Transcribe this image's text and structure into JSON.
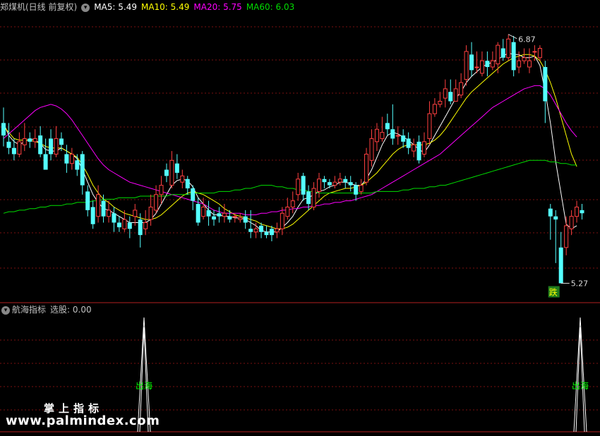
{
  "header": {
    "stock_title": "郑煤机(日线 前复权)",
    "dropdown_icon": "chevron-down-icon",
    "ma5_label": "MA5: 5.49",
    "ma10_label": "MA10: 5.49",
    "ma20_label": "MA20: 5.75",
    "ma60_label": "MA60: 6.03"
  },
  "sub_header": {
    "indicator_name": "航海指标",
    "select_label": "选股: 0.00",
    "dropdown_icon": "chevron-down-icon"
  },
  "colors": {
    "up": "#ff4040",
    "down": "#54ffff",
    "ma5": "#ffffff",
    "ma10": "#ffff00",
    "ma20": "#ff00ff",
    "ma60": "#00dd00",
    "grid": "#7a1010",
    "signal": "#00ff00",
    "fall_badge_bg": "#1e7a1e"
  },
  "watermark": {
    "line1": "掌上指标",
    "line2": "www.palmindex.com"
  },
  "chart_data": [
    {
      "type": "candlestick",
      "title": "郑煤机(日线 前复权)",
      "ylim": [
        5.15,
        7.0
      ],
      "grid": true,
      "annotations": {
        "high_label": "6.87",
        "low_label": "5.27",
        "fall_label": "跌"
      },
      "candles": [
        [
          6.3,
          6.22,
          6.4,
          6.15
        ],
        [
          6.18,
          6.14,
          6.3,
          6.1
        ],
        [
          6.14,
          6.1,
          6.2,
          6.06
        ],
        [
          6.1,
          6.18,
          6.24,
          6.08
        ],
        [
          6.16,
          6.2,
          6.3,
          6.12
        ],
        [
          6.2,
          6.18,
          6.24,
          6.14
        ],
        [
          6.18,
          6.2,
          6.26,
          6.14
        ],
        [
          6.22,
          6.1,
          6.28,
          6.08
        ],
        [
          6.1,
          6.0,
          6.2,
          6.0
        ],
        [
          6.2,
          6.1,
          6.26,
          6.06
        ],
        [
          6.1,
          6.2,
          6.28,
          6.08
        ],
        [
          6.2,
          6.16,
          6.24,
          6.12
        ],
        [
          6.1,
          6.04,
          6.16,
          5.98
        ],
        [
          6.04,
          6.1,
          6.14,
          6.0
        ],
        [
          6.06,
          6.0,
          6.1,
          5.96
        ],
        [
          6.1,
          5.9,
          6.12,
          5.84
        ],
        [
          5.86,
          5.74,
          5.9,
          5.7
        ],
        [
          5.76,
          5.65,
          5.8,
          5.62
        ],
        [
          5.7,
          5.84,
          5.9,
          5.66
        ],
        [
          5.8,
          5.7,
          5.84,
          5.66
        ],
        [
          5.7,
          5.74,
          5.8,
          5.66
        ],
        [
          5.72,
          5.66,
          5.76,
          5.6
        ],
        [
          5.66,
          5.63,
          5.7,
          5.6
        ],
        [
          5.62,
          5.68,
          5.74,
          5.6
        ],
        [
          5.66,
          5.62,
          5.7,
          5.56
        ],
        [
          5.7,
          5.74,
          5.78,
          5.64
        ],
        [
          5.68,
          5.58,
          5.72,
          5.5
        ],
        [
          5.62,
          5.66,
          5.74,
          5.58
        ],
        [
          5.68,
          5.76,
          5.84,
          5.64
        ],
        [
          5.74,
          5.84,
          5.9,
          5.72
        ],
        [
          5.84,
          5.9,
          5.96,
          5.78
        ],
        [
          6.0,
          5.96,
          6.04,
          5.92
        ],
        [
          5.9,
          6.06,
          6.12,
          5.88
        ],
        [
          6.04,
          5.98,
          6.1,
          5.94
        ],
        [
          5.92,
          5.96,
          6.0,
          5.88
        ],
        [
          5.94,
          5.88,
          5.96,
          5.84
        ],
        [
          5.88,
          5.8,
          5.9,
          5.74
        ],
        [
          5.78,
          5.66,
          5.82,
          5.64
        ],
        [
          5.7,
          5.76,
          5.82,
          5.68
        ],
        [
          5.74,
          5.7,
          5.8,
          5.64
        ],
        [
          5.7,
          5.68,
          5.74,
          5.64
        ],
        [
          5.72,
          5.7,
          5.76,
          5.66
        ],
        [
          5.7,
          5.72,
          5.78,
          5.66
        ],
        [
          5.7,
          5.68,
          5.74,
          5.66
        ],
        [
          5.7,
          5.7,
          5.72,
          5.66
        ],
        [
          5.68,
          5.69,
          5.72,
          5.66
        ],
        [
          5.7,
          5.66,
          5.74,
          5.62
        ],
        [
          5.62,
          5.6,
          5.74,
          5.56
        ],
        [
          5.6,
          5.62,
          5.66,
          5.56
        ],
        [
          5.64,
          5.6,
          5.66,
          5.56
        ],
        [
          5.6,
          5.58,
          5.64,
          5.56
        ],
        [
          5.62,
          5.58,
          5.64,
          5.54
        ],
        [
          5.6,
          5.62,
          5.66,
          5.56
        ],
        [
          5.62,
          5.72,
          5.76,
          5.58
        ],
        [
          5.7,
          5.76,
          5.82,
          5.68
        ],
        [
          5.76,
          5.8,
          5.86,
          5.72
        ],
        [
          5.84,
          5.94,
          5.98,
          5.8
        ],
        [
          5.96,
          5.84,
          5.98,
          5.8
        ],
        [
          5.86,
          5.78,
          5.9,
          5.74
        ],
        [
          5.76,
          5.88,
          5.92,
          5.74
        ],
        [
          5.86,
          5.94,
          5.98,
          5.82
        ],
        [
          5.94,
          5.92,
          5.96,
          5.88
        ],
        [
          5.92,
          5.9,
          5.94,
          5.88
        ],
        [
          5.9,
          5.92,
          5.96,
          5.88
        ],
        [
          5.92,
          5.94,
          5.98,
          5.9
        ],
        [
          5.94,
          5.92,
          5.96,
          5.88
        ],
        [
          5.92,
          5.9,
          5.96,
          5.86
        ],
        [
          5.9,
          5.84,
          5.92,
          5.8
        ],
        [
          5.86,
          5.9,
          5.94,
          5.84
        ],
        [
          5.92,
          6.1,
          6.14,
          5.9
        ],
        [
          6.06,
          6.2,
          6.26,
          6.02
        ],
        [
          6.18,
          6.26,
          6.3,
          6.12
        ],
        [
          6.2,
          6.24,
          6.34,
          6.18
        ],
        [
          6.3,
          6.26,
          6.36,
          6.22
        ],
        [
          6.26,
          6.2,
          6.42,
          6.16
        ],
        [
          6.22,
          6.22,
          6.28,
          6.16
        ],
        [
          6.22,
          6.18,
          6.26,
          6.14
        ],
        [
          6.2,
          6.14,
          6.24,
          6.1
        ],
        [
          6.12,
          6.16,
          6.2,
          6.08
        ],
        [
          6.18,
          6.06,
          6.22,
          6.04
        ],
        [
          6.1,
          6.18,
          6.24,
          6.08
        ],
        [
          6.2,
          6.36,
          6.44,
          6.16
        ],
        [
          6.36,
          6.42,
          6.46,
          6.34
        ],
        [
          6.42,
          6.44,
          6.5,
          6.4
        ],
        [
          6.46,
          6.52,
          6.58,
          6.4
        ],
        [
          6.5,
          6.44,
          6.58,
          6.42
        ],
        [
          6.44,
          6.52,
          6.58,
          6.44
        ],
        [
          6.48,
          6.56,
          6.62,
          6.46
        ],
        [
          6.58,
          6.76,
          6.8,
          6.54
        ],
        [
          6.74,
          6.64,
          6.82,
          6.6
        ],
        [
          6.66,
          6.66,
          6.76,
          6.62
        ],
        [
          6.62,
          6.7,
          6.76,
          6.6
        ],
        [
          6.7,
          6.66,
          6.76,
          6.6
        ],
        [
          6.66,
          6.7,
          6.76,
          6.64
        ],
        [
          6.68,
          6.8,
          6.82,
          6.62
        ],
        [
          6.78,
          6.72,
          6.84,
          6.7
        ],
        [
          6.72,
          6.84,
          6.87,
          6.7
        ],
        [
          6.82,
          6.64,
          6.86,
          6.6
        ],
        [
          6.66,
          6.7,
          6.76,
          6.62
        ],
        [
          6.7,
          6.72,
          6.78,
          6.68
        ],
        [
          6.66,
          6.7,
          6.78,
          6.62
        ],
        [
          6.76,
          6.76,
          6.8,
          6.7
        ],
        [
          6.72,
          6.78,
          6.8,
          6.7
        ],
        [
          6.66,
          6.44,
          6.7,
          6.3
        ],
        [
          5.75,
          5.7,
          5.78,
          5.55
        ],
        [
          5.7,
          5.68,
          5.74,
          5.4
        ],
        [
          5.5,
          5.27,
          5.6,
          5.27
        ],
        [
          5.5,
          5.64,
          5.7,
          5.45
        ],
        [
          5.62,
          5.7,
          5.74,
          5.58
        ],
        [
          5.7,
          5.76,
          5.8,
          5.66
        ],
        [
          5.74,
          5.72,
          5.78,
          5.68
        ]
      ],
      "series": [
        {
          "name": "MA5",
          "values": [
            6.3,
            6.22,
            6.18,
            6.16,
            6.18,
            6.2,
            6.19,
            6.17,
            6.13,
            6.12,
            6.12,
            6.14,
            6.12,
            6.1,
            6.07,
            6.0,
            5.92,
            5.84,
            5.79,
            5.75,
            5.74,
            5.72,
            5.7,
            5.68,
            5.66,
            5.66,
            5.66,
            5.66,
            5.68,
            5.72,
            5.78,
            5.84,
            5.9,
            5.93,
            5.94,
            5.93,
            5.89,
            5.82,
            5.78,
            5.74,
            5.71,
            5.71,
            5.7,
            5.7,
            5.69,
            5.69,
            5.68,
            5.66,
            5.64,
            5.61,
            5.6,
            5.6,
            5.6,
            5.63,
            5.66,
            5.7,
            5.76,
            5.81,
            5.82,
            5.84,
            5.86,
            5.87,
            5.89,
            5.9,
            5.92,
            5.92,
            5.91,
            5.9,
            5.9,
            5.94,
            6.0,
            6.08,
            6.16,
            6.22,
            6.24,
            6.23,
            6.21,
            6.19,
            6.16,
            6.13,
            6.11,
            6.16,
            6.22,
            6.28,
            6.34,
            6.4,
            6.46,
            6.5,
            6.56,
            6.6,
            6.63,
            6.66,
            6.68,
            6.69,
            6.71,
            6.73,
            6.75,
            6.74,
            6.74,
            6.72,
            6.72,
            6.73,
            6.67,
            6.5,
            6.3,
            6.05,
            5.85,
            5.65,
            5.62,
            5.64
          ]
        },
        {
          "name": "MA10",
          "values": [
            6.28,
            6.24,
            6.2,
            6.19,
            6.19,
            6.19,
            6.18,
            6.17,
            6.15,
            6.14,
            6.14,
            6.14,
            6.12,
            6.1,
            6.08,
            6.03,
            5.97,
            5.9,
            5.85,
            5.81,
            5.79,
            5.76,
            5.74,
            5.72,
            5.71,
            5.7,
            5.69,
            5.68,
            5.68,
            5.69,
            5.71,
            5.74,
            5.77,
            5.8,
            5.83,
            5.85,
            5.86,
            5.85,
            5.84,
            5.82,
            5.8,
            5.78,
            5.75,
            5.73,
            5.71,
            5.7,
            5.69,
            5.68,
            5.67,
            5.65,
            5.64,
            5.63,
            5.62,
            5.62,
            5.63,
            5.65,
            5.68,
            5.71,
            5.74,
            5.77,
            5.8,
            5.83,
            5.85,
            5.86,
            5.87,
            5.88,
            5.88,
            5.89,
            5.9,
            5.92,
            5.95,
            5.98,
            6.02,
            6.06,
            6.1,
            6.13,
            6.15,
            6.16,
            6.16,
            6.16,
            6.16,
            6.17,
            6.19,
            6.22,
            6.26,
            6.31,
            6.36,
            6.41,
            6.46,
            6.5,
            6.53,
            6.56,
            6.59,
            6.62,
            6.65,
            6.68,
            6.7,
            6.72,
            6.73,
            6.74,
            6.74,
            6.73,
            6.7,
            6.64,
            6.56,
            6.46,
            6.34,
            6.22,
            6.1,
            6.02
          ]
        },
        {
          "name": "MA20",
          "values": [
            6.2,
            6.23,
            6.26,
            6.29,
            6.32,
            6.35,
            6.38,
            6.4,
            6.41,
            6.42,
            6.41,
            6.39,
            6.36,
            6.32,
            6.27,
            6.22,
            6.17,
            6.12,
            6.07,
            6.03,
            6.0,
            5.98,
            5.96,
            5.94,
            5.92,
            5.91,
            5.9,
            5.89,
            5.88,
            5.87,
            5.86,
            5.85,
            5.84,
            5.83,
            5.82,
            5.81,
            5.8,
            5.79,
            5.78,
            5.76,
            5.74,
            5.73,
            5.72,
            5.72,
            5.72,
            5.72,
            5.71,
            5.71,
            5.71,
            5.72,
            5.72,
            5.73,
            5.73,
            5.74,
            5.74,
            5.75,
            5.75,
            5.76,
            5.76,
            5.77,
            5.77,
            5.78,
            5.78,
            5.79,
            5.79,
            5.8,
            5.8,
            5.81,
            5.82,
            5.83,
            5.84,
            5.86,
            5.88,
            5.9,
            5.92,
            5.94,
            5.96,
            5.98,
            6.0,
            6.02,
            6.04,
            6.06,
            6.08,
            6.1,
            6.13,
            6.16,
            6.19,
            6.22,
            6.25,
            6.28,
            6.31,
            6.34,
            6.37,
            6.4,
            6.42,
            6.44,
            6.46,
            6.48,
            6.5,
            6.52,
            6.53,
            6.54,
            6.54,
            6.52,
            6.48,
            6.42,
            6.36,
            6.3,
            6.25,
            6.21
          ]
        },
        {
          "name": "MA60",
          "values": [
            5.72,
            5.73,
            5.73,
            5.74,
            5.74,
            5.75,
            5.75,
            5.76,
            5.76,
            5.77,
            5.77,
            5.77,
            5.78,
            5.78,
            5.79,
            5.79,
            5.79,
            5.8,
            5.8,
            5.81,
            5.81,
            5.81,
            5.82,
            5.82,
            5.82,
            5.82,
            5.83,
            5.83,
            5.83,
            5.83,
            5.83,
            5.83,
            5.84,
            5.84,
            5.84,
            5.84,
            5.85,
            5.85,
            5.85,
            5.85,
            5.85,
            5.86,
            5.86,
            5.86,
            5.87,
            5.87,
            5.88,
            5.88,
            5.89,
            5.9,
            5.9,
            5.9,
            5.89,
            5.89,
            5.88,
            5.88,
            5.87,
            5.87,
            5.86,
            5.86,
            5.85,
            5.85,
            5.85,
            5.85,
            5.85,
            5.85,
            5.85,
            5.85,
            5.85,
            5.85,
            5.85,
            5.86,
            5.86,
            5.86,
            5.86,
            5.86,
            5.87,
            5.87,
            5.88,
            5.88,
            5.88,
            5.89,
            5.89,
            5.9,
            5.9,
            5.91,
            5.92,
            5.93,
            5.94,
            5.95,
            5.96,
            5.97,
            5.98,
            5.99,
            6.0,
            6.01,
            6.02,
            6.03,
            6.04,
            6.05,
            6.06,
            6.06,
            6.06,
            6.06,
            6.05,
            6.05,
            6.04,
            6.04,
            6.03,
            6.03
          ]
        }
      ]
    },
    {
      "type": "line",
      "title": "航海指标",
      "ylim": [
        0,
        1
      ],
      "x": [
        0,
        1
      ],
      "spikes": [
        1,
        1
      ],
      "signal_labels": [
        "出海",
        "出海"
      ]
    }
  ]
}
